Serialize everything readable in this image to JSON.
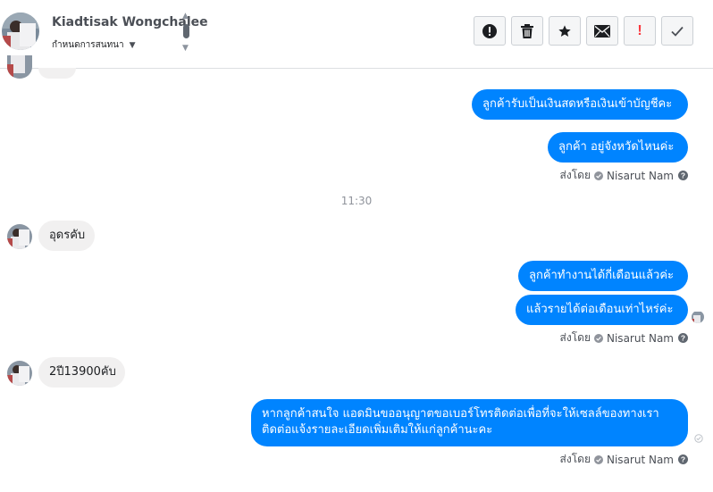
{
  "header": {
    "contact_name": "Kiadtisak Wongchalee",
    "stage_label": "กำหนดการสนทนา",
    "toolbar": [
      {
        "name": "alert-icon",
        "label": "Mark as spam"
      },
      {
        "name": "trash-icon",
        "label": "Delete"
      },
      {
        "name": "star-icon",
        "label": "Star"
      },
      {
        "name": "envelope-icon",
        "label": "Mark as unread"
      },
      {
        "name": "exclamation-icon",
        "label": "!"
      },
      {
        "name": "checkmark-icon",
        "label": "Done"
      }
    ]
  },
  "colors": {
    "outgoing_bubble": "#0084ff",
    "incoming_bubble": "#f1f0f0",
    "sent_by_text": "#4b4f56",
    "timestamp": "#90949c"
  },
  "conversation": {
    "timestamp": "11:30",
    "sent_by_prefix": "ส่งโดย",
    "sender_name": "Nisarut Nam",
    "messages": [
      {
        "dir": "out",
        "text": "ลูกค้ารับเป็นเงินสดหรือเงินเข้าบัญชีคะ"
      },
      {
        "dir": "out",
        "text": "ลูกค้า อยู่จังหวัดไหนค่ะ"
      },
      {
        "dir": "in",
        "text": "อุดรคับ"
      },
      {
        "dir": "out",
        "text": "ลูกค้าทำงานได้กี่เดือนแล้วค่ะ"
      },
      {
        "dir": "out",
        "text": "แล้วรายได้ต่อเดือนเท่าไหร่ค่ะ"
      },
      {
        "dir": "in",
        "text": "2ปี13900คับ"
      },
      {
        "dir": "out",
        "line1": "หากลูกค้าสนใจ แอดมินขออนุญาตขอเบอร์โทรติดต่อเพื่อที่จะให้เซลล์ของทางเรา",
        "line2": "ติดต่อแจ้งรายละเอียดเพิ่มเติมให้แก่ลูกค้านะคะ"
      }
    ]
  }
}
